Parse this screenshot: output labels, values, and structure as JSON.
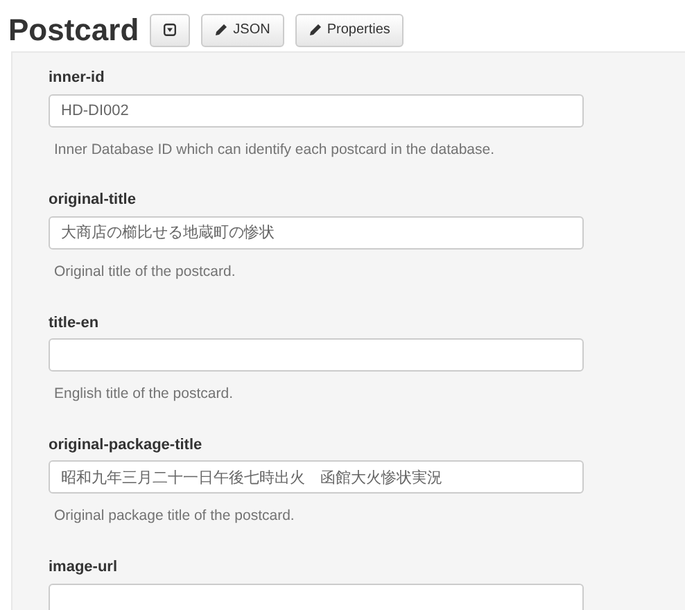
{
  "heading": "Postcard",
  "toolbar": [
    {
      "kind": "toggle"
    },
    {
      "kind": "edit",
      "label": "JSON"
    },
    {
      "kind": "edit",
      "label": "Properties"
    }
  ],
  "fields": [
    {
      "label": "inner-id",
      "value": "HD-DI002",
      "help": "Inner Database ID which can identify each postcard in the database."
    },
    {
      "label": "original-title",
      "value": "大商店の櫛比せる地蔵町の惨状",
      "help": "Original title of the postcard."
    },
    {
      "label": "title-en",
      "help": "English title of the postcard."
    },
    {
      "label": "original-package-title",
      "value": "昭和九年三月二十一日午後七時出火　函館大火惨状実況",
      "help": "Original package title of the postcard."
    },
    {
      "label": "image-url"
    }
  ]
}
